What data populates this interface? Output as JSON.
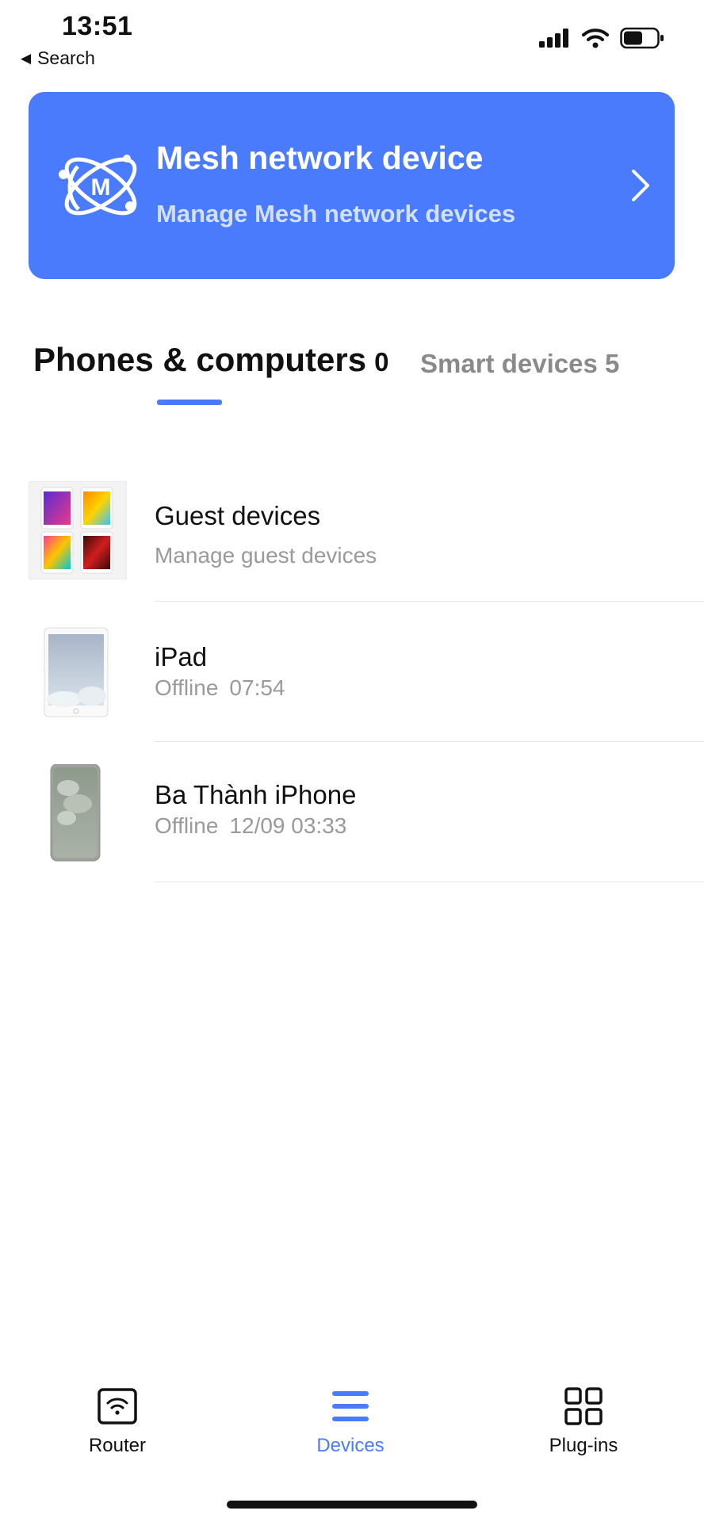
{
  "status": {
    "time": "13:51",
    "back_label": "Search"
  },
  "mesh_card": {
    "title": "Mesh network device",
    "subtitle": "Manage Mesh network devices",
    "logo_letter": "M",
    "color": "#4a7bfc"
  },
  "tabs": [
    {
      "label": "Phones & computers",
      "count": "0",
      "active": true
    },
    {
      "label": "Smart devices",
      "count": "5",
      "active": false
    }
  ],
  "devices": [
    {
      "title": "Guest devices",
      "subtitle": "Manage guest devices",
      "time": "",
      "icon": "guest-devices-icon"
    },
    {
      "title": "iPad",
      "subtitle": "Offline",
      "time": "07:54",
      "icon": "ipad-icon"
    },
    {
      "title": "Ba Thành iPhone",
      "subtitle": "Offline",
      "time": "12/09 03:33",
      "icon": "iphone-icon"
    }
  ],
  "bottom_nav": [
    {
      "label": "Router",
      "icon": "router-icon"
    },
    {
      "label": "Devices",
      "icon": "devices-icon",
      "active": true
    },
    {
      "label": "Plug-ins",
      "icon": "plugins-icon"
    }
  ]
}
